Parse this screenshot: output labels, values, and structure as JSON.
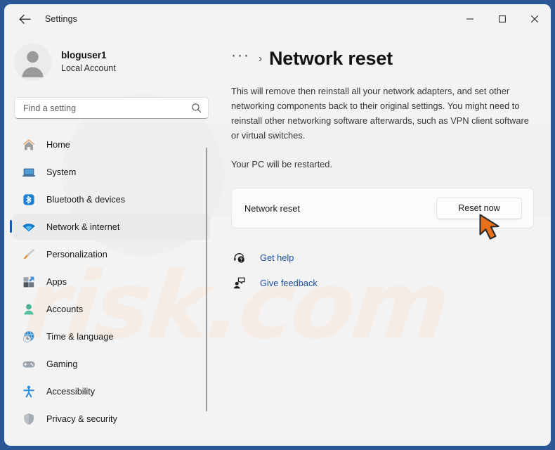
{
  "window": {
    "titlebar_title": "Settings",
    "back_icon": "back-arrow-icon",
    "minimize_label": "─",
    "maximize_label": "☐",
    "close_label": "✕",
    "frame_color": "#2b5797"
  },
  "watermark": {
    "text": "risk.com"
  },
  "account": {
    "name": "bloguser1",
    "type": "Local Account",
    "avatar_icon": "person-avatar-icon"
  },
  "search": {
    "placeholder": "Find a setting",
    "value": "",
    "icon": "search-icon"
  },
  "sidebar": {
    "scrollbar": "sidebar-scrollbar",
    "items": [
      {
        "label": "Home",
        "icon": "home-icon",
        "selected": false
      },
      {
        "label": "System",
        "icon": "system-laptop-icon",
        "selected": false
      },
      {
        "label": "Bluetooth & devices",
        "icon": "bluetooth-icon",
        "selected": false
      },
      {
        "label": "Network & internet",
        "icon": "wifi-icon",
        "selected": true
      },
      {
        "label": "Personalization",
        "icon": "paintbrush-icon",
        "selected": false
      },
      {
        "label": "Apps",
        "icon": "apps-blocks-icon",
        "selected": false
      },
      {
        "label": "Accounts",
        "icon": "accounts-person-icon",
        "selected": false
      },
      {
        "label": "Time & language",
        "icon": "clock-globe-icon",
        "selected": false
      },
      {
        "label": "Gaming",
        "icon": "gamepad-icon",
        "selected": false
      },
      {
        "label": "Accessibility",
        "icon": "accessibility-person-icon",
        "selected": false
      },
      {
        "label": "Privacy & security",
        "icon": "shield-icon",
        "selected": false
      }
    ]
  },
  "main": {
    "breadcrumb_dots": "···",
    "breadcrumb_separator": "›",
    "page_title": "Network reset",
    "description": "This will remove then reinstall all your network adapters, and set other networking components back to their original settings. You might need to reinstall other networking software afterwards, such as VPN client software or virtual switches.",
    "restart_note": "Your PC will be restarted.",
    "card": {
      "label": "Network reset",
      "button_label": "Reset now"
    },
    "links": [
      {
        "label": "Get help",
        "icon": "help-headset-icon"
      },
      {
        "label": "Give feedback",
        "icon": "feedback-person-icon"
      }
    ]
  },
  "annotation": {
    "cursor": "orange-cursor-arrow",
    "cursor_color": "#e8701a"
  },
  "colors": {
    "accent": "#0b5cc0",
    "link": "#1c4e9c",
    "sidebar_selected_bg": "#eaeaea",
    "window_bg": "#f3f3f3"
  }
}
